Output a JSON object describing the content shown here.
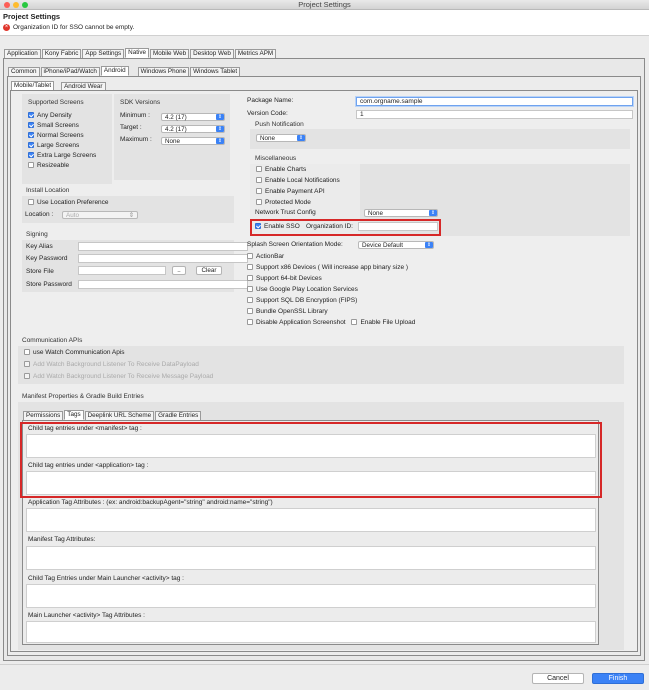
{
  "window": {
    "title": "Project Settings"
  },
  "header": {
    "title": "Project Settings",
    "error": "Organization ID for SSO cannot be empty."
  },
  "main_tabs": [
    "Application",
    "Kony Fabric",
    "App Settings",
    "Native",
    "Mobile Web",
    "Desktop Web",
    "Metrics APM"
  ],
  "native_tabs": [
    "Common",
    "iPhone/iPad/Watch",
    "Android",
    "Windows Phone",
    "Windows Tablet"
  ],
  "android_tabs": [
    "Mobile/Tablet",
    "Android Wear"
  ],
  "supported_screens": {
    "title": "Supported Screens",
    "items": [
      {
        "label": "Any Density",
        "checked": true
      },
      {
        "label": "Small Screens",
        "checked": true
      },
      {
        "label": "Normal Screens",
        "checked": true
      },
      {
        "label": "Large Screens",
        "checked": true
      },
      {
        "label": "Extra Large Screens",
        "checked": true
      },
      {
        "label": "Resizeable",
        "checked": false
      }
    ]
  },
  "sdk": {
    "title": "SDK Versions",
    "minimum_label": "Minimum :",
    "minimum": "4.2 (17)",
    "target_label": "Target :",
    "target": "4.2 (17)",
    "maximum_label": "Maximum :",
    "maximum": "None"
  },
  "install": {
    "title": "Install Location",
    "use_pref": "Use Location Preference",
    "location_label": "Location :",
    "location": "Auto"
  },
  "signing": {
    "title": "Signing",
    "key_alias": "Key Alias",
    "key_password": "Key Password",
    "store_file": "Store File",
    "browse": "..",
    "clear": "Clear",
    "store_password": "Store Password"
  },
  "package": {
    "name_label": "Package Name:",
    "name": "com.orgname.sample",
    "version_label": "Version Code:",
    "version": "1"
  },
  "push": {
    "title": "Push Notification",
    "value": "None"
  },
  "misc": {
    "title": "Miscellaneous",
    "items": [
      "Enable Charts",
      "Enable Local Notifications",
      "Enable Payment API",
      "Protected Mode"
    ],
    "trust_label": "Network Trust Config",
    "trust": "None",
    "sso_label": "Enable SSO",
    "org_label": "Organization ID:"
  },
  "splash": {
    "label": "Splash Screen Orientation Mode:",
    "value": "Device Default"
  },
  "options": [
    "ActionBar",
    "Support x86 Devices   ( Will increase app binary size )",
    "Support 64-bit Devices",
    "Use Google Play Location Services",
    "Support SQL DB Encryption (FIPS)",
    "Bundle OpenSSL Library"
  ],
  "disable_screenshot": "Disable Application Screenshot",
  "enable_upload": "Enable File Upload",
  "comm": {
    "title": "Communication APIs",
    "use_watch": "use Watch Communication Apis",
    "listener1": "Add Watch Background Listener To Receive DataPayload",
    "listener2": "Add Watch Background Listener To Receive Message Payload"
  },
  "manifest": {
    "title": "Manifest Properties & Gradle Build Entries",
    "tabs": [
      "Permissions",
      "Tags",
      "Deeplink URL Scheme",
      "Gradle Entries"
    ],
    "sections": [
      "Child tag entries under <manifest> tag :",
      "Child tag entries under <application> tag :",
      "Application Tag Attributes : (ex: android:backupAgent=\"string\" android:name=\"string\")",
      "Manifest Tag Attributes:",
      "Child Tag Entries under Main Launcher <activity> tag :",
      "Main Launcher <activity> Tag Attributes :"
    ]
  },
  "footer": {
    "cancel": "Cancel",
    "finish": "Finish"
  },
  "colors": {
    "accent": "#3b82f6",
    "error": "#e0362c",
    "highlight": "#d62828"
  }
}
